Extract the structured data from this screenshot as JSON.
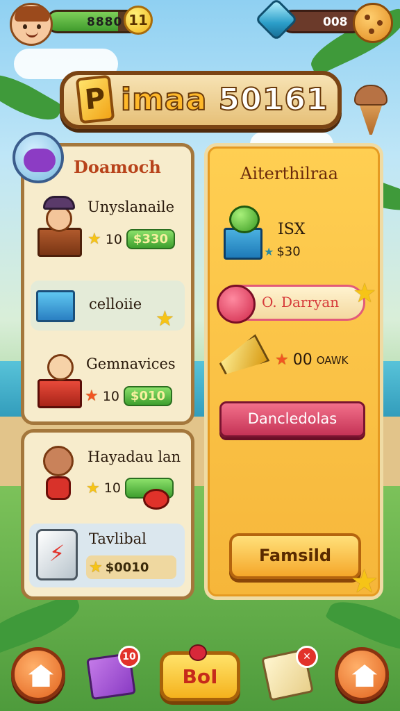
{
  "top_bar": {
    "xp_value": "8880",
    "xp_fill_percent": 75,
    "level": "11",
    "gems_value": "008"
  },
  "title": {
    "icon_letter": "P",
    "text_main": "imaa",
    "text_number": "50161"
  },
  "left_section": {
    "title": "Doamoch",
    "items": [
      {
        "name": "Unyslanaile",
        "stars": "10",
        "price": "$330"
      },
      {
        "name": "celloiie"
      },
      {
        "name": "Gemnavices",
        "stars": "10",
        "price": "$010"
      }
    ]
  },
  "left_section2": {
    "items": [
      {
        "name": "Hayadau lan",
        "stars": "10"
      },
      {
        "name": "Tavlibal",
        "price": "$0010"
      }
    ]
  },
  "right_panel": {
    "title": "Aiterthilraa",
    "offer_qty": "ISX",
    "offer_price": "$30",
    "ribbon_text": "O. Darryan",
    "reward_text": "00",
    "reward_suffix": "OAWK",
    "pink_button": "Dancledolas",
    "yellow_button": "Famsild"
  },
  "bottom_nav": {
    "gift_badge": "10",
    "center_label": "BoI",
    "cards_badge": "✕"
  },
  "colors": {
    "accent_orange": "#f5b21d",
    "brown_border": "#7a4414",
    "panel_cream": "#f7eccc",
    "green_price": "#3e9f2e"
  }
}
